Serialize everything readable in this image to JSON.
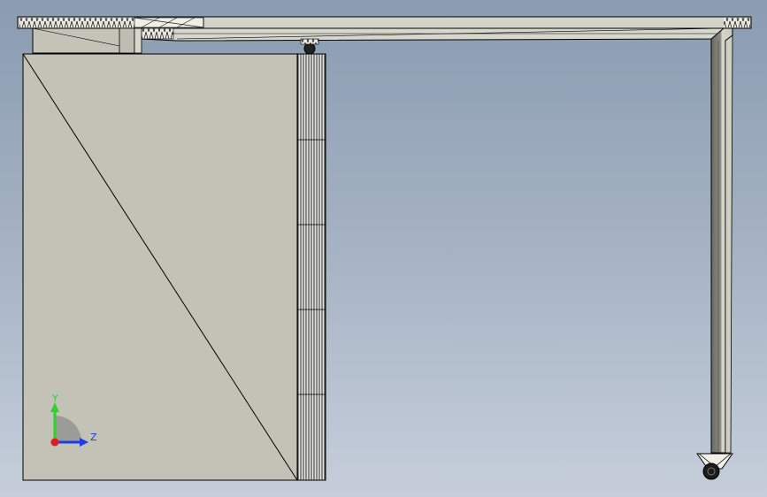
{
  "triad": {
    "y_label": "Y",
    "z_label": "Z",
    "colors": {
      "y": "#2fd12f",
      "z": "#1d3de6",
      "x": "#e11b1b"
    }
  },
  "colors": {
    "background_top": "#8b9cb1",
    "background_bottom": "#c6cedb",
    "part_face": "#c2c2b6",
    "part_light": "#d9d9cf",
    "edge": "#000000"
  }
}
